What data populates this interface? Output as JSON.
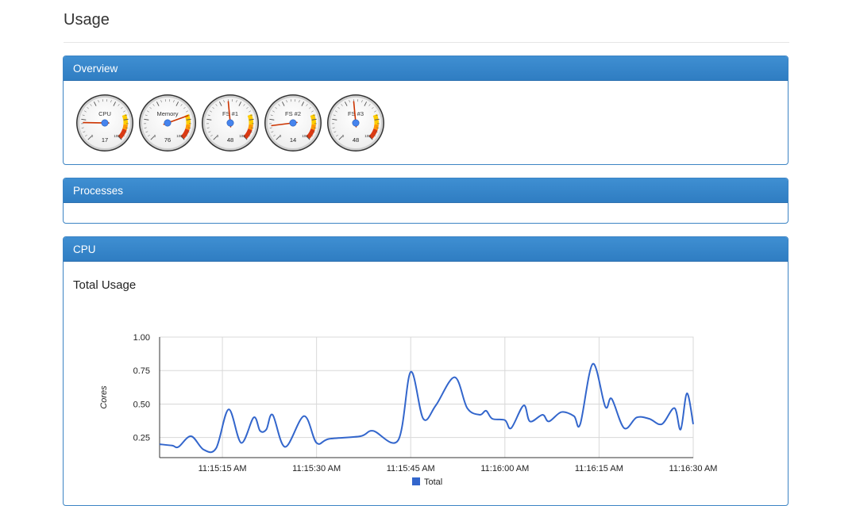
{
  "page": {
    "title": "Usage"
  },
  "overview": {
    "heading": "Overview",
    "gauges": [
      {
        "label": "CPU",
        "value": 17
      },
      {
        "label": "Memory",
        "value": 76
      },
      {
        "label": "FS #1",
        "value": 48
      },
      {
        "label": "FS #2",
        "value": 14
      },
      {
        "label": "FS #3",
        "value": 48
      }
    ],
    "gauge_scale": {
      "min_label": "0",
      "max_label": "100",
      "min": 0,
      "max": 100
    },
    "colors": {
      "needle": "#cc3300",
      "hub": "#4684ee",
      "yellow": "#ffcc00",
      "orange": "#ff9900",
      "red": "#dc3912"
    }
  },
  "processes": {
    "heading": "Processes"
  },
  "cpu": {
    "heading": "CPU",
    "chart_title": "Total Usage"
  },
  "chart_data": {
    "type": "line",
    "title": "Total Usage",
    "ylabel": "Cores",
    "xlabel": "",
    "ylim": [
      0.1,
      1.0
    ],
    "xlim": [
      "11:15:05 AM",
      "11:16:30 AM"
    ],
    "x_ticks": [
      "11:15:15 AM",
      "11:15:30 AM",
      "11:15:45 AM",
      "11:16:00 AM",
      "11:16:15 AM",
      "11:16:30 AM"
    ],
    "y_ticks": [
      "0.25",
      "0.50",
      "0.75",
      "1.00"
    ],
    "grid": true,
    "legend": "bottom",
    "series": [
      {
        "name": "Total",
        "color": "#3366cc",
        "points": [
          [
            "11:15:05 AM",
            0.2
          ],
          [
            "11:15:07 AM",
            0.19
          ],
          [
            "11:15:08 AM",
            0.18
          ],
          [
            "11:15:10 AM",
            0.26
          ],
          [
            "11:15:12 AM",
            0.16
          ],
          [
            "11:15:14 AM",
            0.17
          ],
          [
            "11:15:16 AM",
            0.46
          ],
          [
            "11:15:18 AM",
            0.21
          ],
          [
            "11:15:20 AM",
            0.4
          ],
          [
            "11:15:21 AM",
            0.3
          ],
          [
            "11:15:22 AM",
            0.31
          ],
          [
            "11:15:23 AM",
            0.42
          ],
          [
            "11:15:25 AM",
            0.18
          ],
          [
            "11:15:28 AM",
            0.41
          ],
          [
            "11:15:30 AM",
            0.21
          ],
          [
            "11:15:32 AM",
            0.24
          ],
          [
            "11:15:37 AM",
            0.26
          ],
          [
            "11:15:39 AM",
            0.3
          ],
          [
            "11:15:43 AM",
            0.23
          ],
          [
            "11:15:45 AM",
            0.74
          ],
          [
            "11:15:47 AM",
            0.39
          ],
          [
            "11:15:49 AM",
            0.49
          ],
          [
            "11:15:52 AM",
            0.7
          ],
          [
            "11:15:54 AM",
            0.47
          ],
          [
            "11:15:56 AM",
            0.42
          ],
          [
            "11:15:57 AM",
            0.45
          ],
          [
            "11:15:58 AM",
            0.39
          ],
          [
            "11:16:00 AM",
            0.38
          ],
          [
            "11:16:01 AM",
            0.32
          ],
          [
            "11:16:03 AM",
            0.49
          ],
          [
            "11:16:04 AM",
            0.37
          ],
          [
            "11:16:06 AM",
            0.42
          ],
          [
            "11:16:07 AM",
            0.37
          ],
          [
            "11:16:09 AM",
            0.44
          ],
          [
            "11:16:11 AM",
            0.41
          ],
          [
            "11:16:12 AM",
            0.35
          ],
          [
            "11:16:14 AM",
            0.8
          ],
          [
            "11:16:16 AM",
            0.48
          ],
          [
            "11:16:17 AM",
            0.54
          ],
          [
            "11:16:19 AM",
            0.32
          ],
          [
            "11:16:21 AM",
            0.4
          ],
          [
            "11:16:23 AM",
            0.39
          ],
          [
            "11:16:25 AM",
            0.35
          ],
          [
            "11:16:27 AM",
            0.47
          ],
          [
            "11:16:28 AM",
            0.31
          ],
          [
            "11:16:29 AM",
            0.58
          ],
          [
            "11:16:30 AM",
            0.35
          ]
        ]
      }
    ]
  }
}
